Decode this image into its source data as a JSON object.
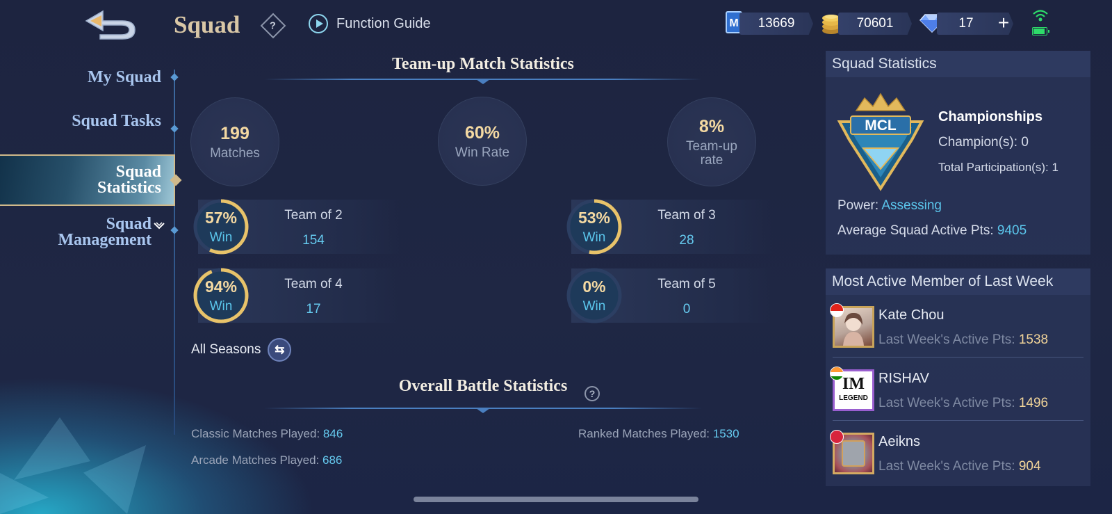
{
  "header": {
    "title": "Squad",
    "help_label": "?",
    "function_guide_label": "Function Guide",
    "currencies": [
      {
        "icon": "m-ticket-icon",
        "value": "13669"
      },
      {
        "icon": "gold-coins-icon",
        "value": "70601"
      },
      {
        "icon": "diamond-icon",
        "value": "17"
      }
    ],
    "add_label": "+"
  },
  "nav": {
    "items": [
      {
        "label": "My Squad"
      },
      {
        "label": "Squad Tasks"
      },
      {
        "label": "Squad Statistics"
      },
      {
        "label": "Squad Management"
      }
    ],
    "active": "Squad Statistics"
  },
  "teamup": {
    "title": "Team-up Match Statistics",
    "summary": [
      {
        "value": "199",
        "label": "Matches"
      },
      {
        "value": "60%",
        "label": "Win Rate"
      },
      {
        "value": "8%",
        "label": "Team-up rate"
      }
    ],
    "teams": [
      {
        "win_pct": "57%",
        "win_fraction": 0.57,
        "win_label": "Win",
        "name": "Team of 2",
        "count": "154"
      },
      {
        "win_pct": "53%",
        "win_fraction": 0.53,
        "win_label": "Win",
        "name": "Team of 3",
        "count": "28"
      },
      {
        "win_pct": "94%",
        "win_fraction": 0.94,
        "win_label": "Win",
        "name": "Team of 4",
        "count": "17"
      },
      {
        "win_pct": "0%",
        "win_fraction": 0.0,
        "win_label": "Win",
        "name": "Team of 5",
        "count": "0"
      }
    ],
    "seasons_label": "All Seasons"
  },
  "battle": {
    "title": "Overall Battle Statistics",
    "help_label": "?",
    "classic_label": "Classic Matches Played:",
    "classic_value": "846",
    "ranked_label": "Ranked Matches Played:",
    "ranked_value": "1530",
    "arcade_label": "Arcade Matches Played:",
    "arcade_value": "686"
  },
  "squad_stats": {
    "title": "Squad Statistics",
    "emblem_text": "MCL",
    "championships_title": "Championships",
    "champions_text": "Champion(s): 0",
    "participation_text": "Total Participation(s): 1",
    "power_label": "Power:",
    "power_value": "Assessing",
    "avg_label": "Average Squad Active Pts:",
    "avg_value": "9405"
  },
  "active_members": {
    "title": "Most Active Member of Last Week",
    "pts_label": "Last Week's Active Pts:",
    "members": [
      {
        "name": "Kate Chou",
        "pts": "1538",
        "flag": "indonesia"
      },
      {
        "name": "RISHAV",
        "pts": "1496",
        "flag": "india"
      },
      {
        "name": "Aeikns",
        "pts": "904",
        "flag": "unknown-red"
      }
    ],
    "avatar_texts": [
      "IM",
      "LEGEND"
    ]
  },
  "colors": {
    "accent_blue": "#5bc6ec",
    "gold_text": "#f4d9a2",
    "ring_gold": "#e8c36a"
  }
}
